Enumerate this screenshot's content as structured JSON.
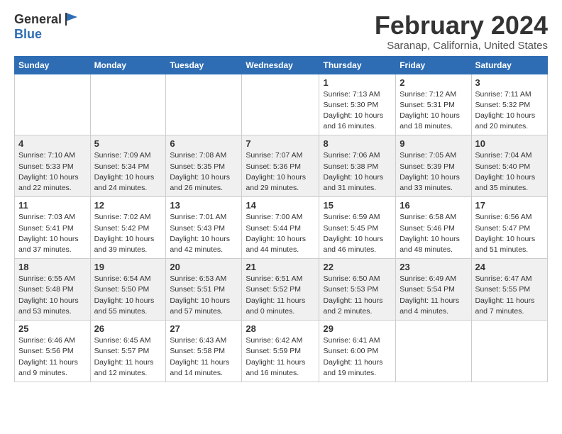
{
  "header": {
    "logo_general": "General",
    "logo_blue": "Blue",
    "main_title": "February 2024",
    "subtitle": "Saranap, California, United States"
  },
  "weekdays": [
    "Sunday",
    "Monday",
    "Tuesday",
    "Wednesday",
    "Thursday",
    "Friday",
    "Saturday"
  ],
  "weeks": [
    [
      {
        "num": "",
        "info": ""
      },
      {
        "num": "",
        "info": ""
      },
      {
        "num": "",
        "info": ""
      },
      {
        "num": "",
        "info": ""
      },
      {
        "num": "1",
        "info": "Sunrise: 7:13 AM\nSunset: 5:30 PM\nDaylight: 10 hours and 16 minutes."
      },
      {
        "num": "2",
        "info": "Sunrise: 7:12 AM\nSunset: 5:31 PM\nDaylight: 10 hours and 18 minutes."
      },
      {
        "num": "3",
        "info": "Sunrise: 7:11 AM\nSunset: 5:32 PM\nDaylight: 10 hours and 20 minutes."
      }
    ],
    [
      {
        "num": "4",
        "info": "Sunrise: 7:10 AM\nSunset: 5:33 PM\nDaylight: 10 hours and 22 minutes."
      },
      {
        "num": "5",
        "info": "Sunrise: 7:09 AM\nSunset: 5:34 PM\nDaylight: 10 hours and 24 minutes."
      },
      {
        "num": "6",
        "info": "Sunrise: 7:08 AM\nSunset: 5:35 PM\nDaylight: 10 hours and 26 minutes."
      },
      {
        "num": "7",
        "info": "Sunrise: 7:07 AM\nSunset: 5:36 PM\nDaylight: 10 hours and 29 minutes."
      },
      {
        "num": "8",
        "info": "Sunrise: 7:06 AM\nSunset: 5:38 PM\nDaylight: 10 hours and 31 minutes."
      },
      {
        "num": "9",
        "info": "Sunrise: 7:05 AM\nSunset: 5:39 PM\nDaylight: 10 hours and 33 minutes."
      },
      {
        "num": "10",
        "info": "Sunrise: 7:04 AM\nSunset: 5:40 PM\nDaylight: 10 hours and 35 minutes."
      }
    ],
    [
      {
        "num": "11",
        "info": "Sunrise: 7:03 AM\nSunset: 5:41 PM\nDaylight: 10 hours and 37 minutes."
      },
      {
        "num": "12",
        "info": "Sunrise: 7:02 AM\nSunset: 5:42 PM\nDaylight: 10 hours and 39 minutes."
      },
      {
        "num": "13",
        "info": "Sunrise: 7:01 AM\nSunset: 5:43 PM\nDaylight: 10 hours and 42 minutes."
      },
      {
        "num": "14",
        "info": "Sunrise: 7:00 AM\nSunset: 5:44 PM\nDaylight: 10 hours and 44 minutes."
      },
      {
        "num": "15",
        "info": "Sunrise: 6:59 AM\nSunset: 5:45 PM\nDaylight: 10 hours and 46 minutes."
      },
      {
        "num": "16",
        "info": "Sunrise: 6:58 AM\nSunset: 5:46 PM\nDaylight: 10 hours and 48 minutes."
      },
      {
        "num": "17",
        "info": "Sunrise: 6:56 AM\nSunset: 5:47 PM\nDaylight: 10 hours and 51 minutes."
      }
    ],
    [
      {
        "num": "18",
        "info": "Sunrise: 6:55 AM\nSunset: 5:48 PM\nDaylight: 10 hours and 53 minutes."
      },
      {
        "num": "19",
        "info": "Sunrise: 6:54 AM\nSunset: 5:50 PM\nDaylight: 10 hours and 55 minutes."
      },
      {
        "num": "20",
        "info": "Sunrise: 6:53 AM\nSunset: 5:51 PM\nDaylight: 10 hours and 57 minutes."
      },
      {
        "num": "21",
        "info": "Sunrise: 6:51 AM\nSunset: 5:52 PM\nDaylight: 11 hours and 0 minutes."
      },
      {
        "num": "22",
        "info": "Sunrise: 6:50 AM\nSunset: 5:53 PM\nDaylight: 11 hours and 2 minutes."
      },
      {
        "num": "23",
        "info": "Sunrise: 6:49 AM\nSunset: 5:54 PM\nDaylight: 11 hours and 4 minutes."
      },
      {
        "num": "24",
        "info": "Sunrise: 6:47 AM\nSunset: 5:55 PM\nDaylight: 11 hours and 7 minutes."
      }
    ],
    [
      {
        "num": "25",
        "info": "Sunrise: 6:46 AM\nSunset: 5:56 PM\nDaylight: 11 hours and 9 minutes."
      },
      {
        "num": "26",
        "info": "Sunrise: 6:45 AM\nSunset: 5:57 PM\nDaylight: 11 hours and 12 minutes."
      },
      {
        "num": "27",
        "info": "Sunrise: 6:43 AM\nSunset: 5:58 PM\nDaylight: 11 hours and 14 minutes."
      },
      {
        "num": "28",
        "info": "Sunrise: 6:42 AM\nSunset: 5:59 PM\nDaylight: 11 hours and 16 minutes."
      },
      {
        "num": "29",
        "info": "Sunrise: 6:41 AM\nSunset: 6:00 PM\nDaylight: 11 hours and 19 minutes."
      },
      {
        "num": "",
        "info": ""
      },
      {
        "num": "",
        "info": ""
      }
    ]
  ]
}
